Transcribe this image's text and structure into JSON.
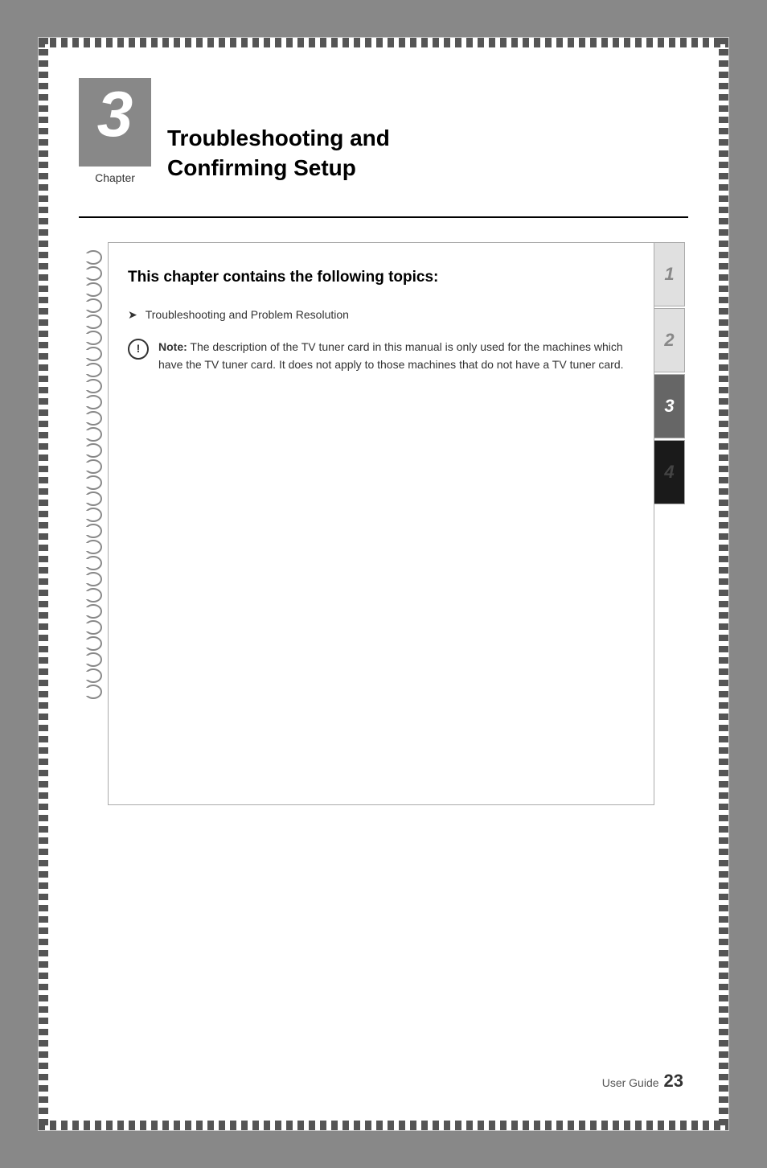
{
  "page": {
    "background_color": "#888",
    "chapter": {
      "number": "3",
      "label": "Chapter",
      "title_line1": "Troubleshooting and",
      "title_line2": "Confirming Setup"
    },
    "toc": {
      "heading": "This chapter contains the following topics:",
      "items": [
        {
          "text": "Troubleshooting and Problem Resolution"
        }
      ]
    },
    "note": {
      "icon_text": "!",
      "label": "Note:",
      "body": " The description of the TV tuner card in this manual is only used for the machines which have the TV tuner card. It does not apply to those machines that do not have a TV tuner card."
    },
    "tabs": [
      {
        "label": "1"
      },
      {
        "label": "2"
      },
      {
        "label": "3"
      },
      {
        "label": "4"
      }
    ],
    "footer": {
      "label": "User Guide",
      "page": "23"
    },
    "rings_count": 28
  }
}
